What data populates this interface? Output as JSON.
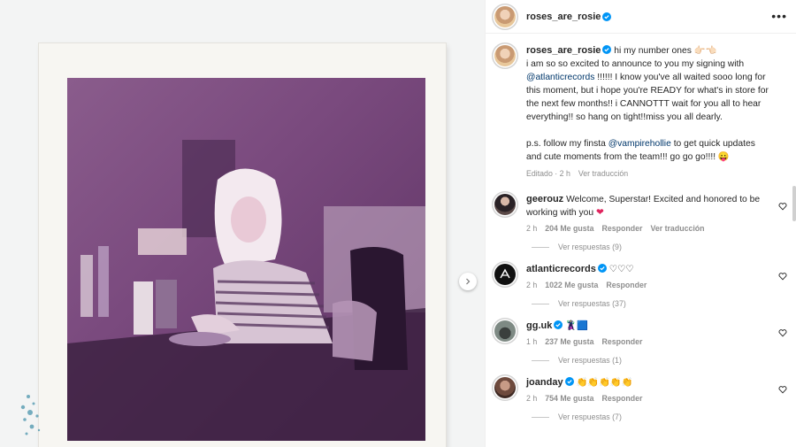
{
  "post": {
    "username": "roses_are_rosie",
    "caption_line1": "hi my number ones 👉🏻👈🏻",
    "caption_line2": "i am so so excited to announce to you my signing with",
    "caption_mention": "@atlanticrecords",
    "caption_line3": " !!!!!! I know you've all waited sooo long for this moment, but i hope you're READY for what's in store for the next few months!! i CANNOTTT wait for you all to hear everything!! so hang on tight!!miss you all dearly.",
    "caption_ps_prefix": "p.s. follow my finsta ",
    "caption_ps_mention": "@vampirehollie",
    "caption_ps_suffix": " to get quick updates and cute moments from the team!!! go go go!!!! 😛",
    "edited_label": "Editado",
    "time": "2 h",
    "translate_label": "Ver traducción"
  },
  "comments": [
    {
      "username": "geerouz",
      "verified": false,
      "text": "Welcome, Superstar! Excited and honored to be working with you",
      "emoji": "❤",
      "time": "2 h",
      "likes": "204 Me gusta",
      "reply_label": "Responder",
      "translate_label": "Ver traducción",
      "replies_label": "Ver respuestas (9)"
    },
    {
      "username": "atlanticrecords",
      "verified": true,
      "text": "♡♡♡",
      "emoji": "",
      "time": "2 h",
      "likes": "1022 Me gusta",
      "reply_label": "Responder",
      "translate_label": "",
      "replies_label": "Ver respuestas (37)"
    },
    {
      "username": "gg.uk",
      "verified": true,
      "text": "",
      "emoji": "🦹🏻‍♀️🟦",
      "time": "1 h",
      "likes": "237 Me gusta",
      "reply_label": "Responder",
      "translate_label": "",
      "replies_label": "Ver respuestas (1)"
    },
    {
      "username": "joanday",
      "verified": true,
      "text": "",
      "emoji": "👏👏👏👏👏",
      "time": "2 h",
      "likes": "754 Me gusta",
      "reply_label": "Responder",
      "translate_label": "",
      "replies_label": "Ver respuestas (7)"
    }
  ],
  "colors": {
    "link": "#00376b",
    "verified": "#0095f6",
    "muted": "#8e8e8e"
  }
}
